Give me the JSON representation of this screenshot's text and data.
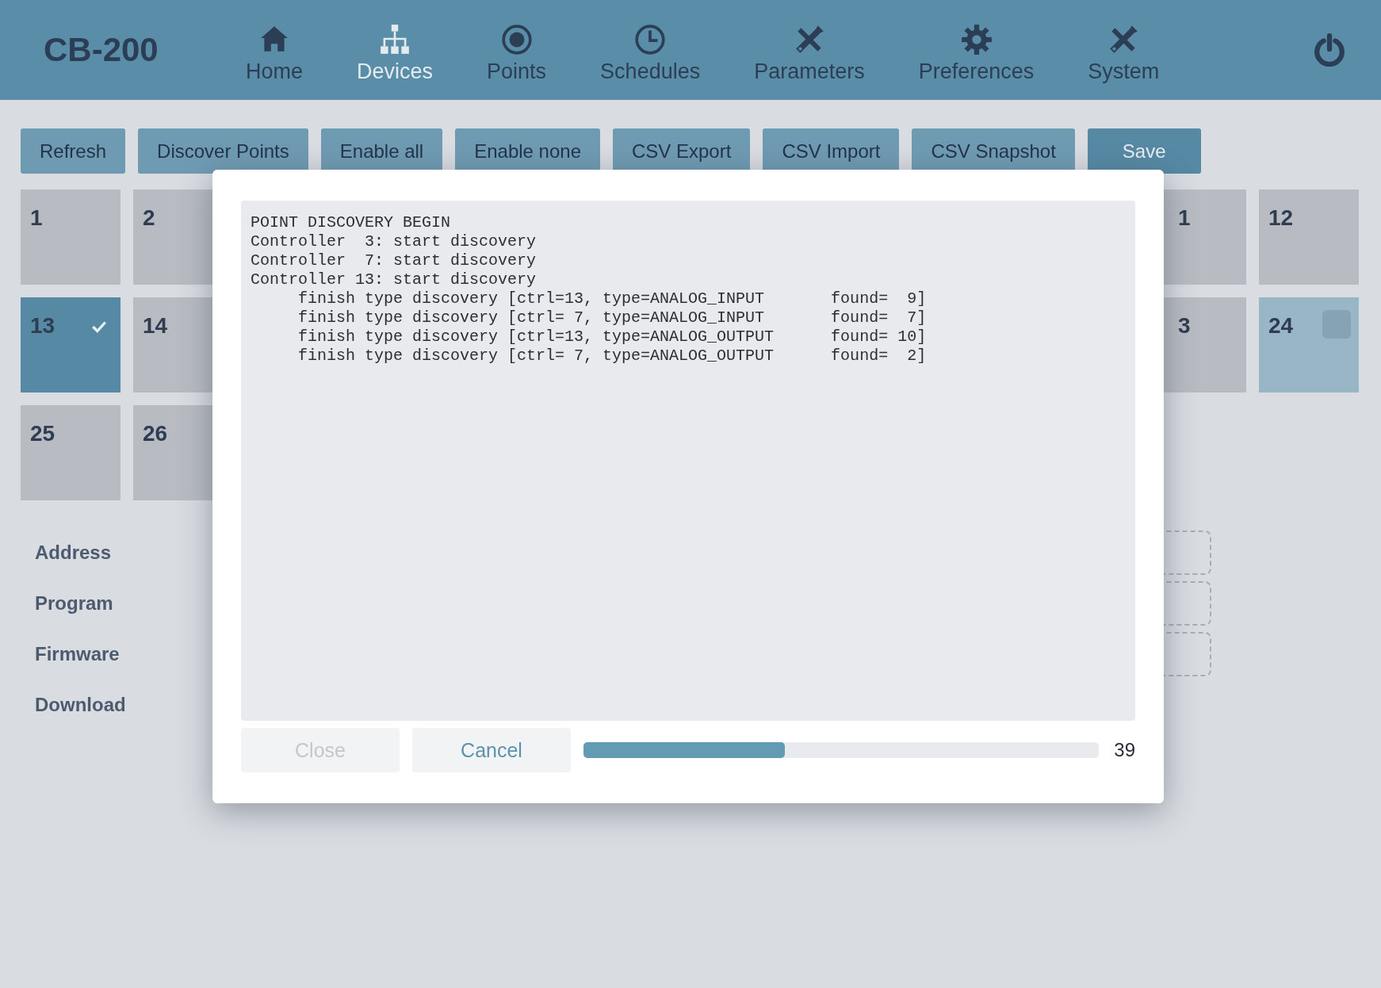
{
  "app": {
    "title": "CB-200"
  },
  "nav": [
    {
      "label": "Home",
      "selected": false
    },
    {
      "label": "Devices",
      "selected": true
    },
    {
      "label": "Points",
      "selected": false
    },
    {
      "label": "Schedules",
      "selected": false
    },
    {
      "label": "Parameters",
      "selected": false
    },
    {
      "label": "Preferences",
      "selected": false
    },
    {
      "label": "System",
      "selected": false
    }
  ],
  "toolbar": [
    {
      "label": "Refresh",
      "primary": false
    },
    {
      "label": "Discover Points",
      "primary": false
    },
    {
      "label": "Enable all",
      "primary": false
    },
    {
      "label": "Enable none",
      "primary": false
    },
    {
      "label": "CSV Export",
      "primary": false
    },
    {
      "label": "CSV Import",
      "primary": false
    },
    {
      "label": "CSV Snapshot",
      "primary": false
    },
    {
      "label": "Save",
      "primary": true
    }
  ],
  "tile_rows": [
    {
      "left": [
        {
          "label": "1",
          "checked": false,
          "highlighted": false
        },
        {
          "label": "2",
          "checked": false,
          "highlighted": false
        }
      ],
      "right": [
        {
          "label": "1",
          "checked": false,
          "highlighted": false,
          "partly_hidden": true
        },
        {
          "label": "12",
          "checked": false,
          "highlighted": false
        }
      ]
    },
    {
      "left": [
        {
          "label": "13",
          "checked": true,
          "highlighted": false
        },
        {
          "label": "14",
          "checked": false,
          "highlighted": false
        }
      ],
      "right": [
        {
          "label": "3",
          "checked": false,
          "highlighted": false,
          "partly_hidden": true
        },
        {
          "label": "24",
          "checked": false,
          "highlighted": true
        }
      ]
    },
    {
      "left": [
        {
          "label": "25",
          "checked": false,
          "highlighted": false
        },
        {
          "label": "26",
          "checked": false,
          "highlighted": false
        }
      ]
    }
  ],
  "form": [
    {
      "label": "Address",
      "kind": "field"
    },
    {
      "label": "Program",
      "kind": "field"
    },
    {
      "label": "Firmware",
      "kind": "field"
    },
    {
      "label": "Download",
      "kind": "plain"
    }
  ],
  "dialog": {
    "log": [
      "POINT DISCOVERY BEGIN",
      "Controller  3: start discovery",
      "Controller  7: start discovery",
      "Controller 13: start discovery",
      "     finish type discovery [ctrl=13, type=ANALOG_INPUT       found=  9]",
      "     finish type discovery [ctrl= 7, type=ANALOG_INPUT       found=  7]",
      "     finish type discovery [ctrl=13, type=ANALOG_OUTPUT      found= 10]",
      "     finish type discovery [ctrl= 7, type=ANALOG_OUTPUT      found=  2]"
    ],
    "buttons": [
      {
        "label": "Close",
        "disabled": true
      },
      {
        "label": "Cancel",
        "disabled": false
      }
    ],
    "progress": {
      "level": 0.39,
      "reading": "39"
    }
  }
}
